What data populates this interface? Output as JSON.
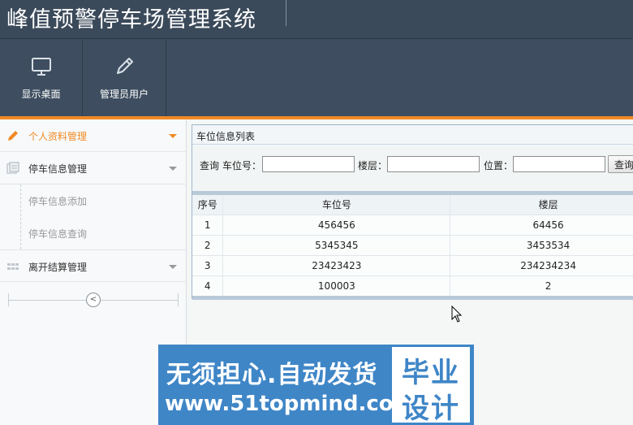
{
  "app": {
    "title": "峰值预警停车场管理系统"
  },
  "toolbar": [
    {
      "label": "显示桌面",
      "icon": "monitor-icon"
    },
    {
      "label": "管理员用户",
      "icon": "pencil-icon"
    }
  ],
  "sidebar": {
    "items": [
      {
        "label": "个人资料管理",
        "icon": "pencil-icon",
        "active": true
      },
      {
        "label": "停车信息管理",
        "icon": "document-icon"
      },
      {
        "label": "离开结算管理",
        "icon": "grid-icon"
      }
    ],
    "subitems": [
      {
        "label": "停车信息添加"
      },
      {
        "label": "停车信息查询"
      }
    ],
    "collapse_glyph": "<"
  },
  "panel": {
    "title": "车位信息列表",
    "search": {
      "query_label": "查询",
      "space_no_label": "车位号：",
      "floor_label": "楼层：",
      "position_label": "位置：",
      "space_no_value": "",
      "floor_value": "",
      "position_value": "",
      "button_label": "查询"
    },
    "columns": [
      "序号",
      "车位号",
      "楼层"
    ],
    "rows": [
      [
        "1",
        "456456",
        "64456"
      ],
      [
        "2",
        "5345345",
        "3453534"
      ],
      [
        "3",
        "23423423",
        "234234234"
      ],
      [
        "4",
        "100003",
        "2"
      ]
    ]
  },
  "banner": {
    "line1": "无须担心.自动发货",
    "line2": "www.51topmind.com",
    "box_top": "毕业",
    "box_bottom": "设计"
  },
  "colors": {
    "accent": "#f08a24",
    "header": "#3e4e60",
    "banner": "#3f86c7"
  }
}
